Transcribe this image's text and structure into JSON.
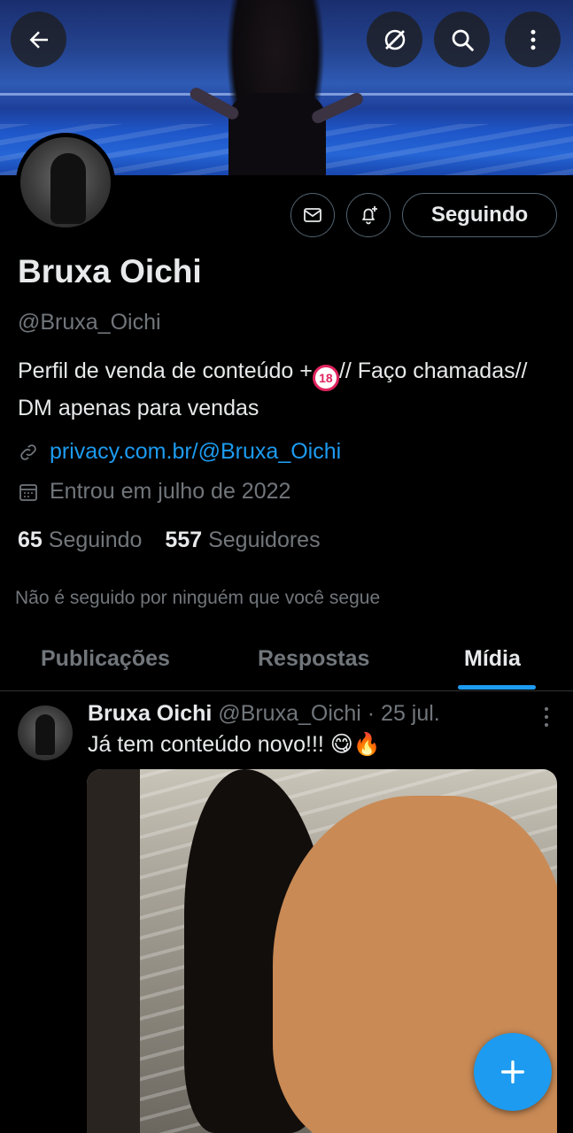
{
  "header": {
    "back_icon": "arrow-left-icon",
    "grok_icon": "slash-circle-icon",
    "search_icon": "search-icon",
    "more_icon": "more-vertical-icon"
  },
  "profile": {
    "name": "Bruxa Oichi",
    "handle": "@Bruxa_Oichi",
    "bio_part1": "Perfil de venda de conteúdo +",
    "bio_badge": "18",
    "bio_part2": "// Faço chamadas// DM apenas para vendas",
    "link": "privacy.com.br/@Bruxa_Oichi",
    "joined": "Entrou em julho de 2022",
    "following_count": "65",
    "following_label": "Seguindo",
    "followers_count": "557",
    "followers_label": "Seguidores",
    "not_followed": "Não é seguido por ninguém que você segue"
  },
  "actions": {
    "message_icon": "envelope-icon",
    "notify_icon": "bell-plus-icon",
    "follow_label": "Seguindo"
  },
  "tabs": [
    {
      "label": "Publicações"
    },
    {
      "label": "Respostas"
    },
    {
      "label": "Mídia"
    }
  ],
  "tweet": {
    "name": "Bruxa Oichi",
    "meta": "@Bruxa_Oichi · 25 jul.",
    "text": "Já tem conteúdo novo!!! 😋🔥"
  },
  "fab": {
    "icon": "plus-icon"
  },
  "colors": {
    "accent": "#1d9bf0",
    "text_primary": "#e7e9ea",
    "text_secondary": "#71767b",
    "background": "#000000"
  }
}
